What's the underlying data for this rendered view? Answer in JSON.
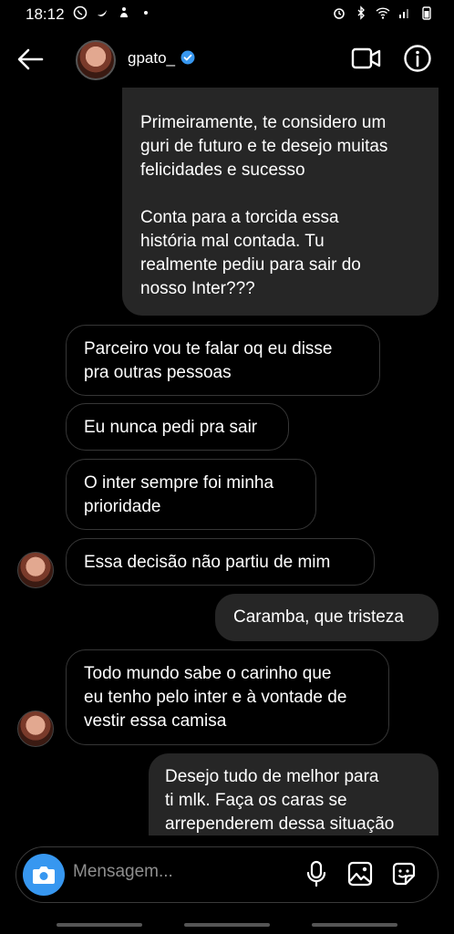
{
  "status": {
    "time": "18:12"
  },
  "header": {
    "username": "gpato_"
  },
  "messages": [
    {
      "text": "Primeiramente, te considero um\nguri de futuro e te desejo muitas\nfelicidades e sucesso\n\nConta para a torcida essa\nhistória mal contada. Tu\nrealmente pediu para sair do\nnosso Inter???"
    },
    {
      "text": "Parceiro vou te falar oq eu disse\npra outras pessoas"
    },
    {
      "text": "Eu nunca pedi pra sair"
    },
    {
      "text": "O inter sempre foi minha\nprioridade"
    },
    {
      "text": "Essa decisão não partiu de mim"
    },
    {
      "text": "Caramba, que tristeza"
    },
    {
      "text": "Todo mundo sabe o carinho que\neu tenho pelo inter e à vontade de\nvestir essa camisa"
    },
    {
      "text": "Desejo tudo de melhor para\nti mlk. Faça os caras se\narrependerem dessa situação"
    }
  ],
  "composer": {
    "placeholder": "Mensagem..."
  },
  "colors": {
    "accent": "#3797f0",
    "sent_bubble": "#262626",
    "recv_border": "#363636"
  }
}
